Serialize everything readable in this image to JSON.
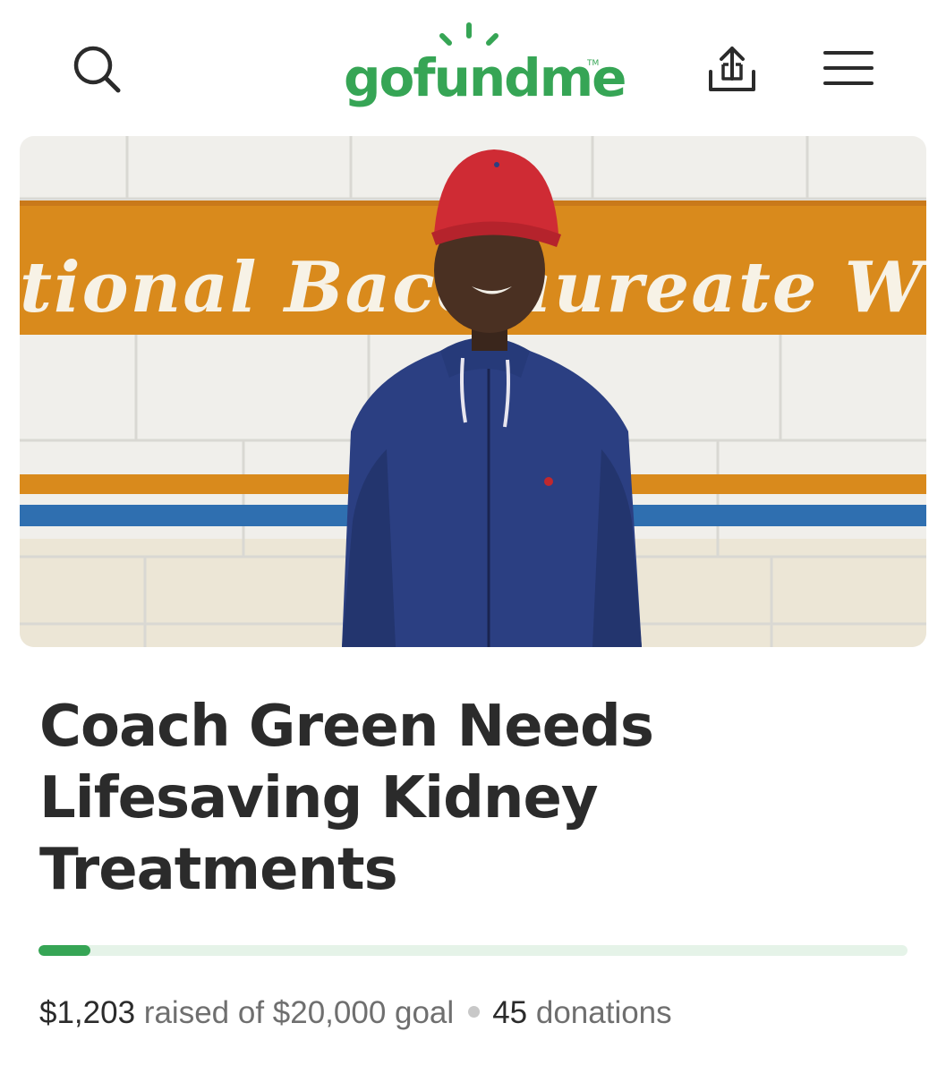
{
  "header": {
    "logo_text": "gofundme",
    "logo_tm": "TM",
    "icons": {
      "search": "search-icon",
      "share": "share-icon",
      "menu": "hamburger-menu-icon"
    }
  },
  "hero": {
    "banner_text": "tional Bacc aureate W",
    "image_subject": "man in red cap and navy zip jacket in front of painted block wall"
  },
  "campaign": {
    "title": "Coach Green Needs Lifesaving Kidney Treatments",
    "raised": "$1,203",
    "raised_of_text": "raised of $20,000 goal",
    "donations_count": "45",
    "donations_label": "donations",
    "progress_fraction": 0.06
  },
  "colors": {
    "brand_green": "#36a555",
    "progress_track": "#e5f3e8",
    "text_dark": "#2b2b2b",
    "text_muted": "#6f6f6f",
    "banner_orange": "#d98a1c",
    "stripe_blue": "#2f6fb0"
  }
}
